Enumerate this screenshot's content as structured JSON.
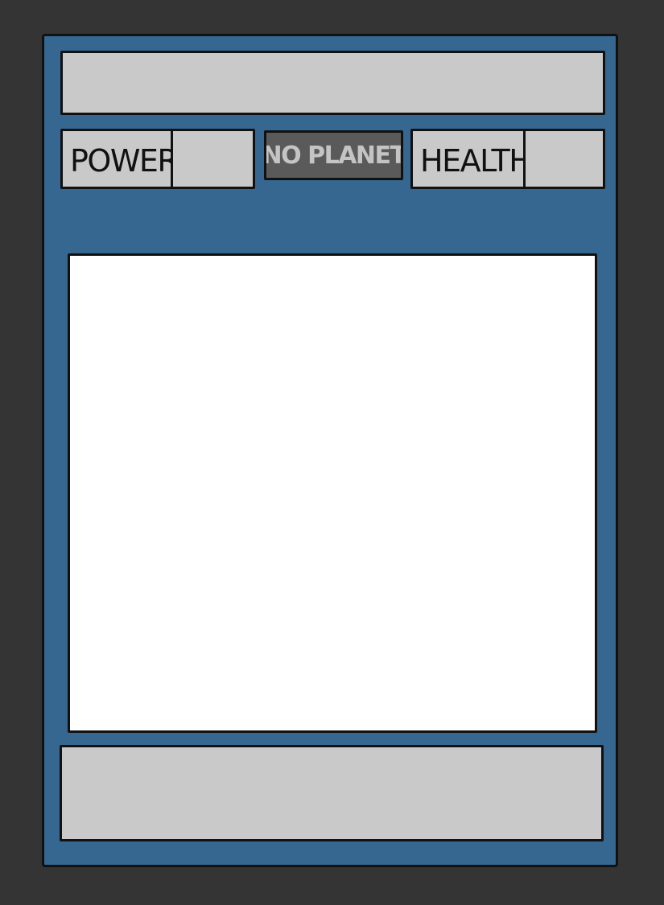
{
  "card": {
    "title": "",
    "power": {
      "label": "POWER",
      "value": ""
    },
    "planet": {
      "label": "NO PLANET"
    },
    "health": {
      "label": "HEALTH",
      "value": ""
    },
    "description": "",
    "colors": {
      "background": "#343434",
      "frame": "#356791",
      "panel": "#c9c9c9",
      "planet_badge": "#5a5a5a",
      "planet_text": "#c4c4c4",
      "artwork": "#ffffff"
    }
  }
}
